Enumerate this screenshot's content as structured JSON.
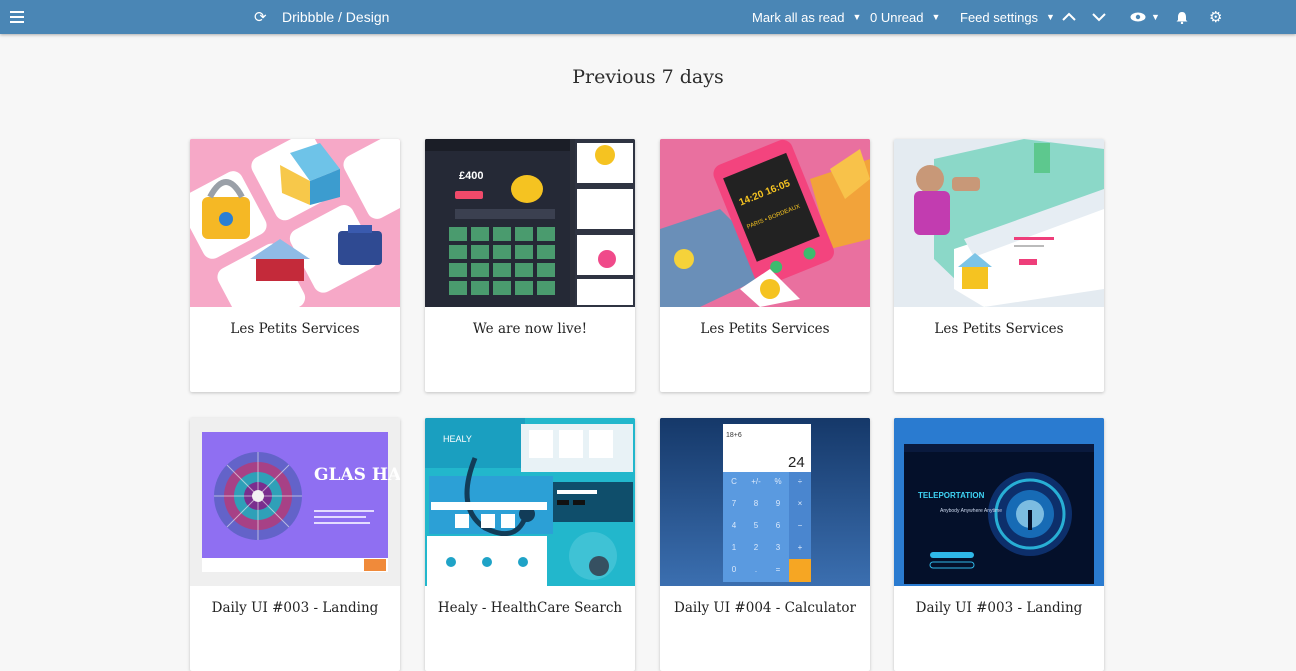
{
  "topbar": {
    "title": "Dribbble / Design",
    "mark_all_as_read": "Mark all as read",
    "unread": "0 Unread",
    "feed_settings": "Feed settings"
  },
  "section_heading": "Previous 7 days",
  "cards": [
    {
      "title": "Les Petits Services"
    },
    {
      "title": "We are now live!"
    },
    {
      "title": "Les Petits Services"
    },
    {
      "title": "Les Petits Services"
    },
    {
      "title": "Daily UI #003 - Landing"
    },
    {
      "title": "Healy - HealthCare Search"
    },
    {
      "title": "Daily UI #004 - Calculator"
    },
    {
      "title": "Daily UI #003 - Landing"
    }
  ],
  "thumb_text": {
    "glas_haus": "GLAS HAUS",
    "healy": "HEALY",
    "calc_expr": "18+6",
    "calc_result": "24",
    "teleportation": "TELEPORTATION",
    "teleport_lines": "Anybody Anywhere Anytime",
    "lottery_price": "£400",
    "app_times": "14:20 16:05",
    "app_cities": "PARIS • BORDEAUX"
  },
  "calc_keys": [
    "C",
    "+/-",
    "%",
    "÷",
    "7",
    "8",
    "9",
    "×",
    "4",
    "5",
    "6",
    "−",
    "1",
    "2",
    "3",
    "+",
    "0",
    ".",
    "="
  ],
  "colors": {
    "topbar": "#4a86b5",
    "background": "#f7f7f7",
    "accent_pink": "#f28ab2"
  },
  "icons": [
    "menu-icon",
    "refresh-icon",
    "chevron-down-icon",
    "arrow-up-icon",
    "arrow-down-icon",
    "eye-icon",
    "bell-icon",
    "gear-icon"
  ]
}
